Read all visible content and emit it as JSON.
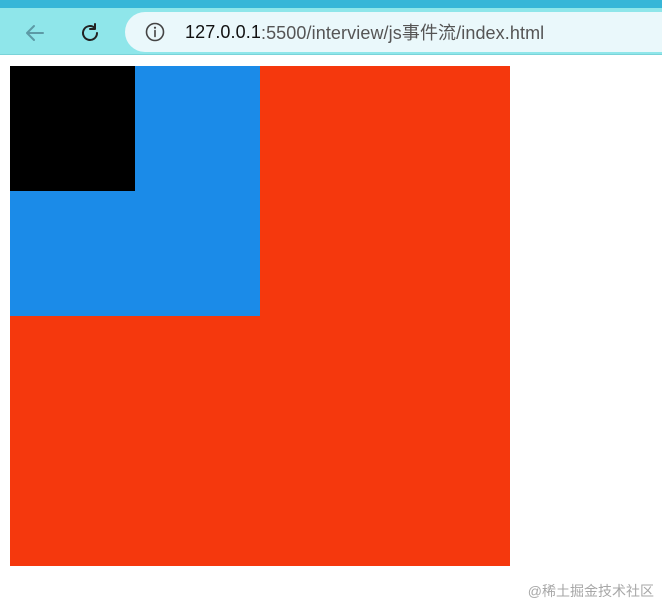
{
  "browser": {
    "url_host": "127.0.0.1",
    "url_path": ":5500/interview/js事件流/index.html",
    "icons": {
      "back": "arrow-left-icon",
      "reload": "reload-icon",
      "site_info": "info-icon"
    }
  },
  "page": {
    "boxes": {
      "outer_color": "#f5380d",
      "middle_color": "#1b8be8",
      "inner_color": "#000000"
    }
  },
  "watermark": {
    "text": "@稀土掘金技术社区"
  }
}
